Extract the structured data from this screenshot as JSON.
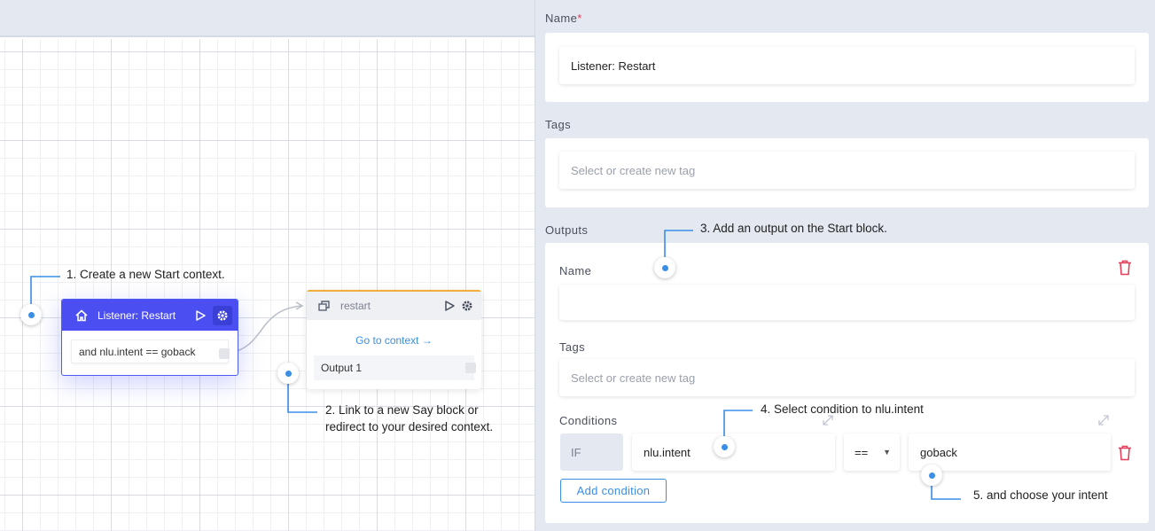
{
  "canvas": {
    "listener_node": {
      "title": "Listener: Restart",
      "condition": "and nlu.intent == goback"
    },
    "restart_node": {
      "title": "restart",
      "goto_label": "Go to context",
      "output_label": "Output 1"
    },
    "annotations": {
      "step1": "1. Create a new Start context.",
      "step2_line1": "2. Link to a new Say block or",
      "step2_line2": "redirect to your desired context."
    }
  },
  "panel": {
    "name_label": "Name",
    "required_mark": "*",
    "name_value": "Listener: Restart",
    "tags_label": "Tags",
    "tags_placeholder": "Select or create new tag",
    "outputs_label": "Outputs",
    "output": {
      "name_label": "Name",
      "name_value": "",
      "tags_label": "Tags",
      "tags_placeholder": "Select or create new tag",
      "conditions_label": "Conditions",
      "if_label": "IF",
      "condition_field": "nlu.intent",
      "operator": "==",
      "condition_value": "goback",
      "add_condition_label": "Add condition"
    },
    "annotations": {
      "step3": "3. Add an output on the Start block.",
      "step4": "4. Select condition to nlu.intent",
      "step5": "5. and choose your intent"
    }
  },
  "colors": {
    "accent_blue": "#3a8ee6",
    "listener_header": "#4b4ff2",
    "restart_border": "#f2ae3b",
    "delete_red": "#e53e5a",
    "panel_bg": "#e4e8f0"
  },
  "icons": [
    "home-icon",
    "play-icon",
    "gear-icon",
    "context-icon",
    "arrow-right-icon",
    "trash-icon",
    "expand-icon",
    "caret-down-icon"
  ]
}
